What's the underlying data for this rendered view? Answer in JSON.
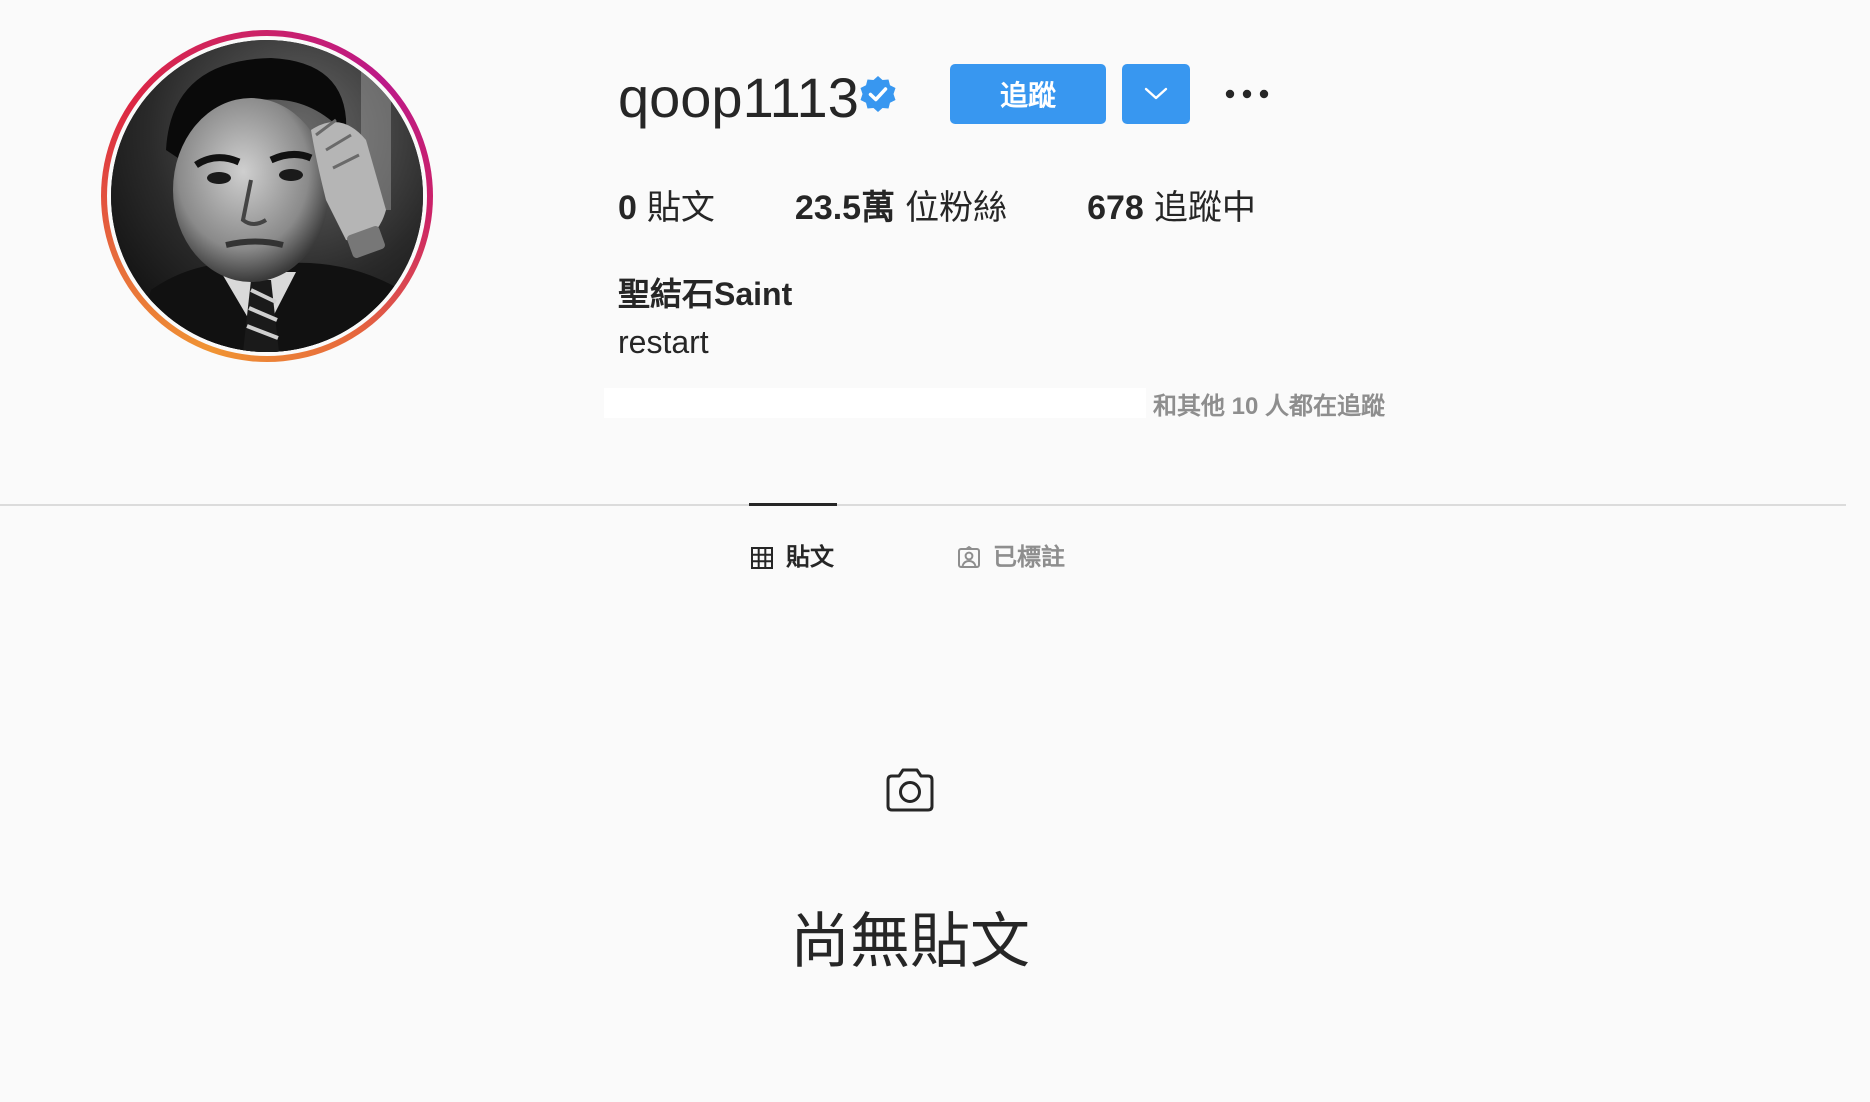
{
  "profile": {
    "username": "qoop1113",
    "verified": true,
    "follow_label": "追蹤",
    "stats": [
      {
        "num": "0",
        "label": "貼文"
      },
      {
        "num": "23.5萬",
        "label": "位粉絲"
      },
      {
        "num": "678",
        "label": "追蹤中"
      }
    ],
    "full_name": "聖結石Saint",
    "bio": "restart",
    "followed_by": "和其他 10 人都在追蹤"
  },
  "tabs": [
    {
      "label": "貼文",
      "active": true,
      "icon": "grid-icon"
    },
    {
      "label": "已標註",
      "active": false,
      "icon": "tagged-person-icon"
    }
  ],
  "empty_state": {
    "icon": "camera-icon",
    "text": "尚無貼文"
  },
  "colors": {
    "accent": "#3897f0",
    "background": "#fafafa",
    "text": "#262626",
    "muted": "#8e8e8e",
    "divider": "#dbdbdb"
  }
}
